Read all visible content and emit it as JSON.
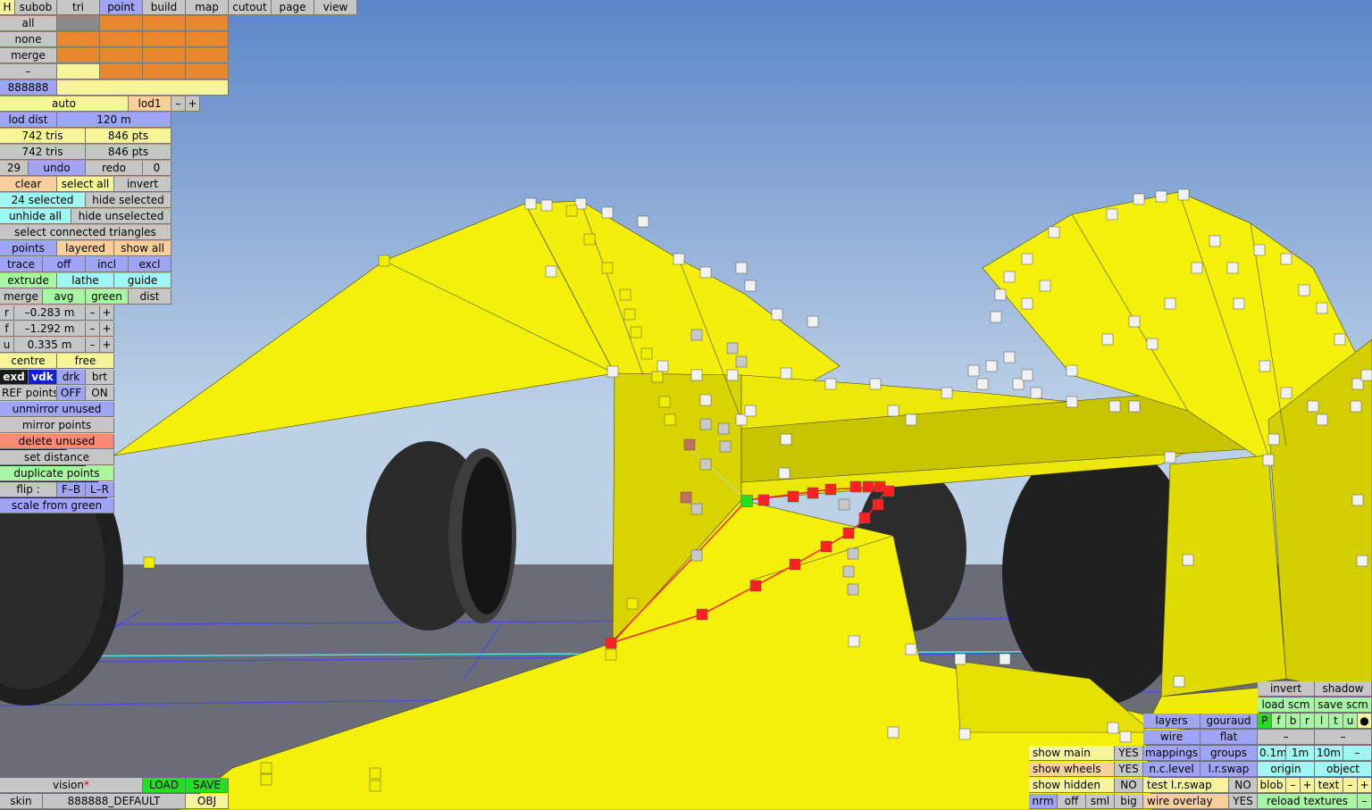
{
  "colors": {
    "sky_top": "#5b86c8",
    "sky_bottom": "#bcd0e6",
    "ground": "#6a6c78",
    "body_yellow": "#f5f00a",
    "selection_red": "#ff2020",
    "grid_blue": "#4a4adf"
  },
  "top_tabs": {
    "h": "H",
    "subob": "subob",
    "tri": "tri",
    "point": "point",
    "build": "build",
    "map": "map",
    "cutout": "cutout",
    "page": "page",
    "view": "view"
  },
  "select_rows": {
    "all": "all",
    "none": "none",
    "merge": "merge",
    "minus": "–",
    "color_code": "888888"
  },
  "lod": {
    "auto": "auto",
    "lod1": "lod1",
    "minus": "–",
    "plus": "+",
    "dist_label": "lod dist",
    "dist_value": "120 m"
  },
  "stats": {
    "tris_a": "742 tris",
    "pts_a": "846 pts",
    "tris_b": "742 tris",
    "pts_b": "846 pts"
  },
  "history": {
    "undo_count": "29",
    "undo": "undo",
    "redo": "redo",
    "redo_count": "0"
  },
  "ops": {
    "clear": "clear",
    "select_all": "select all",
    "invert": "invert",
    "selected": "24 selected",
    "hide_selected": "hide selected",
    "unhide_all": "unhide all",
    "hide_unselected": "hide unselected",
    "select_connected": "select connected triangles",
    "points": "points",
    "layered": "layered",
    "show_all": "show all",
    "trace": "trace",
    "off": "off",
    "incl": "incl",
    "excl": "excl",
    "extrude": "extrude",
    "lathe": "lathe",
    "guide": "guide",
    "merge": "merge",
    "avg": "avg",
    "green": "green",
    "dist": "dist"
  },
  "coords": [
    {
      "axis": "r",
      "value": "–0.283 m",
      "minus": "–",
      "plus": "+"
    },
    {
      "axis": "f",
      "value": "–1.292 m",
      "minus": "–",
      "plus": "+"
    },
    {
      "axis": "u",
      "value": "0.335 m",
      "minus": "–",
      "plus": "+"
    }
  ],
  "pivot": {
    "centre": "centre",
    "free": "free"
  },
  "display_modes": {
    "exd": "exd",
    "vdk": "vdk",
    "drk": "drk",
    "brt": "brt"
  },
  "ref_points": {
    "label": "REF points",
    "off": "OFF",
    "on": "ON"
  },
  "actions": {
    "unmirror_unused": "unmirror unused",
    "mirror_points": "mirror points",
    "delete_unused": "delete unused",
    "set_distance": "set distance",
    "duplicate_points": "duplicate points",
    "flip_label": "flip :",
    "flip_fb": "F–B",
    "flip_lr": "L–R",
    "scale_from_green": "scale from green"
  },
  "bottom_left": {
    "vision": "vision",
    "vision_star": "*",
    "load": "LOAD",
    "save": "SAVE",
    "skin": "skin",
    "skin_name": "888888_DEFAULT",
    "obj": "OBJ"
  },
  "bottom_right": {
    "invert": "invert",
    "shadow": "shadow",
    "load_scm": "load scm",
    "save_scm": "save scm",
    "layer_letters": [
      "P",
      "f",
      "b",
      "r",
      "l",
      "t",
      "u",
      "●"
    ],
    "layers": "layers",
    "gouraud": "gouraud",
    "wire": "wire",
    "flat": "flat",
    "dash_a": "–",
    "dash_b": "–",
    "show_main": "show main",
    "show_main_val": "YES",
    "mappings": "mappings",
    "groups": "groups",
    "d01": "0.1m",
    "d1": "1m",
    "d10": "10m",
    "dminus": "–",
    "show_wheels": "show wheels",
    "show_wheels_val": "YES",
    "nc_level": "n.c.level",
    "lr_swap": "l.r.swap",
    "origin": "origin",
    "object": "object",
    "show_hidden": "show hidden",
    "show_hidden_val": "NO",
    "test_lr_swap": "test l.r.swap",
    "test_lr_swap_val": "NO",
    "blob": "blob",
    "blob_minus": "–",
    "blob_plus": "+",
    "text": "text",
    "text_minus": "–",
    "text_plus": "+",
    "nrm": "nrm",
    "off": "off",
    "sml": "sml",
    "big": "big",
    "wire_overlay": "wire overlay",
    "wire_overlay_val": "YES",
    "reload_textures": "reload textures",
    "reload_minus": "–"
  }
}
